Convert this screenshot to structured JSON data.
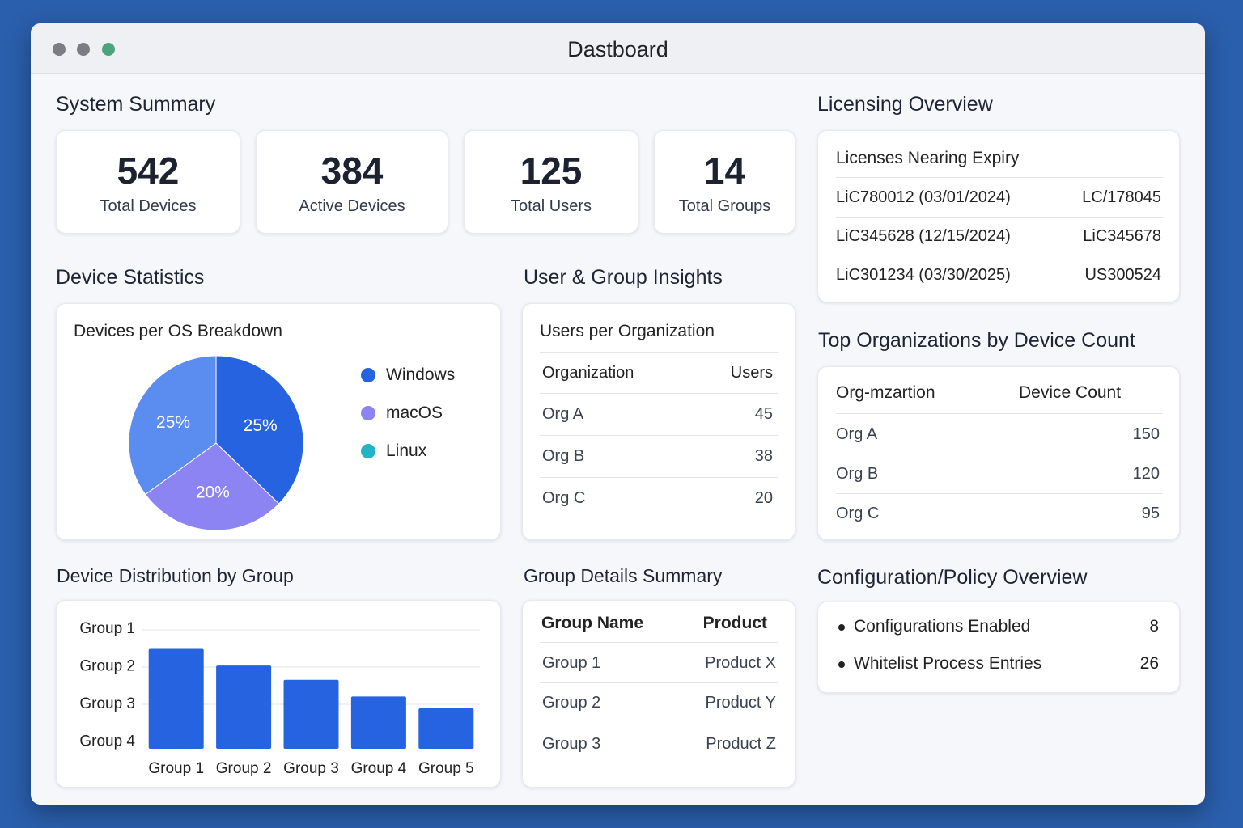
{
  "window": {
    "title": "Dastboard"
  },
  "system_summary": {
    "title": "System Summary",
    "stats": [
      {
        "value": "542",
        "label": "Total Devices"
      },
      {
        "value": "384",
        "label": "Active Devices"
      },
      {
        "value": "125",
        "label": "Total Users"
      },
      {
        "value": "14",
        "label": "Total Groups"
      }
    ]
  },
  "device_statistics": {
    "title": "Device Statistics",
    "card_title": "Devices per OS Breakdown",
    "legend": [
      {
        "label": "Windows",
        "color": "#2563e0"
      },
      {
        "label": "macOS",
        "color": "#8b84f2"
      },
      {
        "label": "Linux",
        "color": "#22b4c4"
      }
    ]
  },
  "user_group_insights": {
    "title": "User & Group Insights",
    "card_title": "Users per Organization",
    "columns": [
      "Organization",
      "Users"
    ],
    "rows": [
      {
        "org": "Org A",
        "users": "45"
      },
      {
        "org": "Org B",
        "users": "38"
      },
      {
        "org": "Org C",
        "users": "20"
      }
    ]
  },
  "device_distribution": {
    "title": "Device Distribution by Group"
  },
  "group_details": {
    "title": "Group Details Summary",
    "columns": [
      "Group Name",
      "Product"
    ],
    "rows": [
      {
        "group": "Group 1",
        "product": "Product X"
      },
      {
        "group": "Group 2",
        "product": "Product Y"
      },
      {
        "group": "Group 3",
        "product": "Product Z"
      }
    ]
  },
  "licensing": {
    "title": "Licensing Overview",
    "card_title": "Licenses Nearing Expiry",
    "rows": [
      {
        "license": "LiC780012 (03/01/2024)",
        "code": "LC/178045"
      },
      {
        "license": "LiC345628 (12/15/2024)",
        "code": "LiC345678"
      },
      {
        "license": "LiC301234 (03/30/2025)",
        "code": "US300524"
      }
    ]
  },
  "top_orgs": {
    "title": "Top Organizations by Device Count",
    "columns": [
      "Org-mzartion",
      "Device Count"
    ],
    "rows": [
      {
        "org": "Org A",
        "count": "150"
      },
      {
        "org": "Org B",
        "count": "120"
      },
      {
        "org": "Org C",
        "count": "95"
      }
    ]
  },
  "config_policy": {
    "title": "Configuration/Policy Overview",
    "items": [
      {
        "label": "Configurations Enabled",
        "value": "8"
      },
      {
        "label": "Whitelist Process Entries",
        "value": "26"
      }
    ]
  },
  "chart_data": [
    {
      "type": "pie",
      "title": "Devices per OS Breakdown",
      "slices": [
        {
          "name": "Windows",
          "label": "25%",
          "color": "#2563e0",
          "share_degrees": 134
        },
        {
          "name": "macOS",
          "label": "20%",
          "color": "#8b84f2",
          "share_degrees": 100
        },
        {
          "name": "Linux",
          "label": "25%",
          "color": "#5b8cf0",
          "share_degrees": 126
        }
      ]
    },
    {
      "type": "bar",
      "title": "Device Distribution by Group",
      "categories": [
        "Group 1",
        "Group 2",
        "Group 3",
        "Group 4",
        "Group 5"
      ],
      "values": [
        4.2,
        3.5,
        2.9,
        2.2,
        1.7
      ],
      "y_tick_labels": [
        "Group 1",
        "Group 2",
        "Group 3",
        "Group 4"
      ],
      "color": "#2563e0",
      "grid": true
    }
  ]
}
